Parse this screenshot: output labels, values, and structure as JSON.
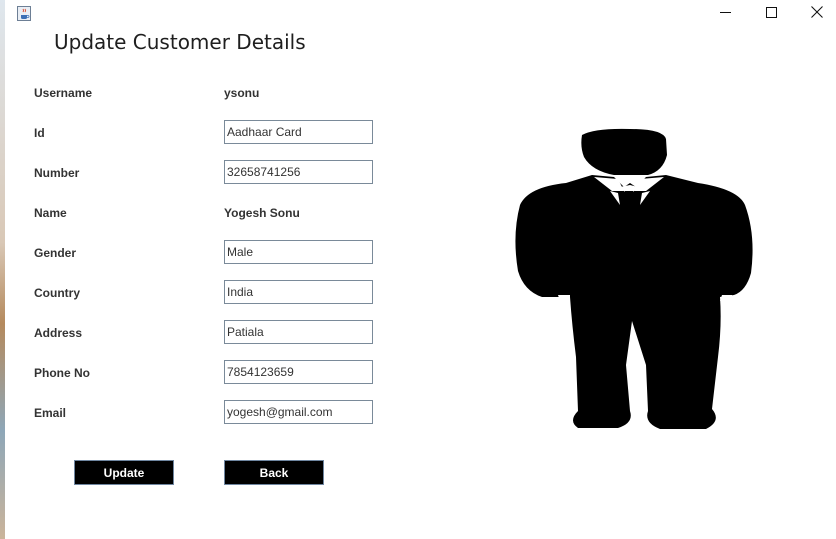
{
  "window": {
    "title_icon": "java-cup-icon",
    "controls": {
      "minimize": "minimize-icon",
      "maximize": "maximize-icon",
      "close": "close-icon"
    }
  },
  "form": {
    "heading": "Update Customer Details",
    "fields": [
      {
        "label": "Username",
        "value": "ysonu",
        "type": "text"
      },
      {
        "label": "Id",
        "value": "Aadhaar Card",
        "type": "input"
      },
      {
        "label": "Number",
        "value": "32658741256",
        "type": "input"
      },
      {
        "label": "Name",
        "value": "Yogesh Sonu",
        "type": "text"
      },
      {
        "label": "Gender",
        "value": "Male",
        "type": "input"
      },
      {
        "label": "Country",
        "value": "India",
        "type": "input"
      },
      {
        "label": "Address",
        "value": "Patiala",
        "type": "input"
      },
      {
        "label": "Phone No",
        "value": "7854123659",
        "type": "input"
      },
      {
        "label": "Email",
        "value": "yogesh@gmail.com",
        "type": "input"
      }
    ],
    "buttons": {
      "update": "Update",
      "back": "Back"
    }
  },
  "image": {
    "icon": "businessman-silhouette-icon"
  },
  "colors": {
    "button_bg": "#000000",
    "button_text": "#ffffff",
    "label_text": "#333333"
  }
}
